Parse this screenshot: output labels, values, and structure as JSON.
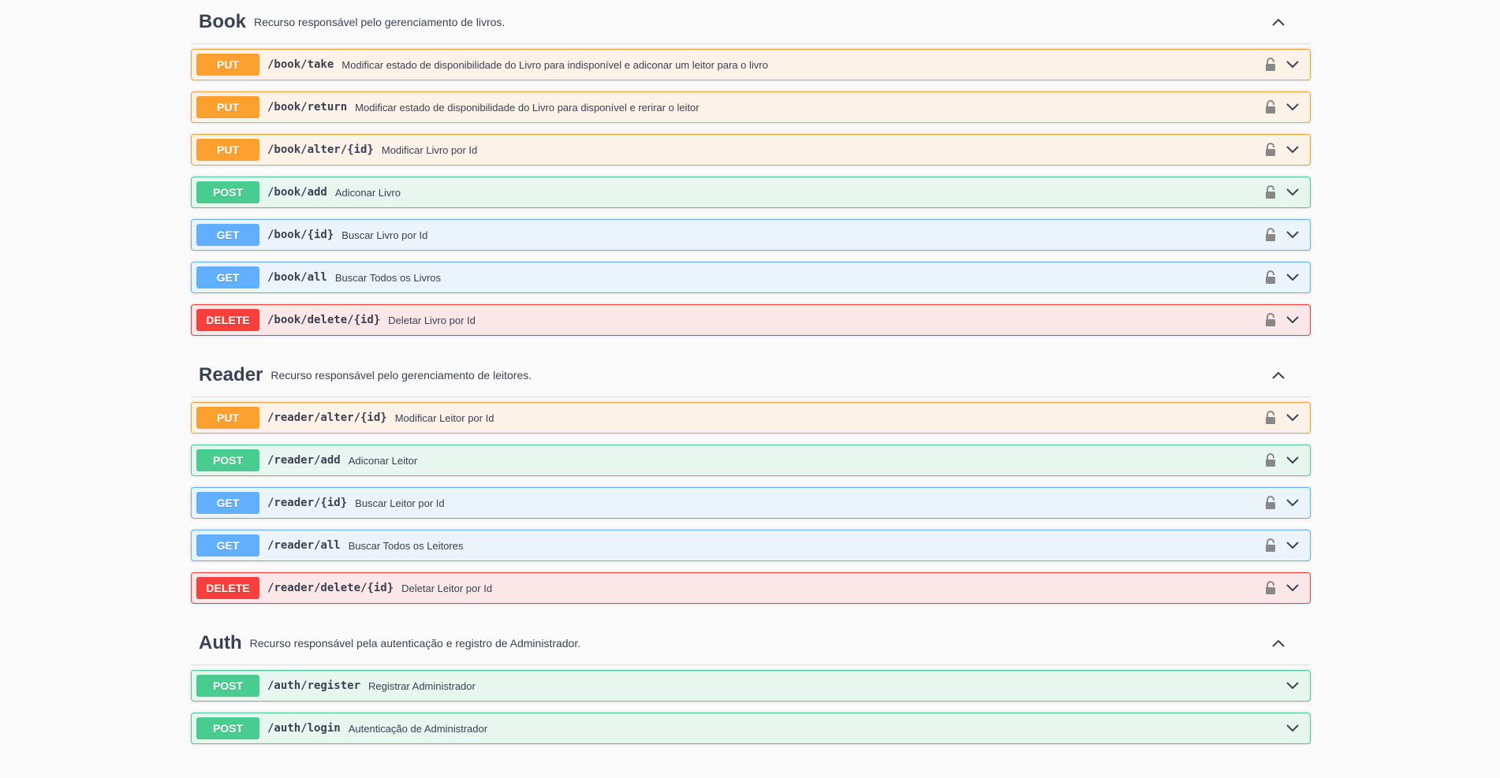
{
  "colors": {
    "put": "#fca130",
    "post": "#49cc90",
    "get": "#61affe",
    "delete": "#f93e3e"
  },
  "sections": [
    {
      "name": "Book",
      "description": "Recurso responsável pelo gerenciamento de livros.",
      "operations": [
        {
          "method": "PUT",
          "path": "/book/take",
          "summary": "Modificar estado de disponibilidade do Livro para indisponível e adiconar um leitor para o livro",
          "locked": true
        },
        {
          "method": "PUT",
          "path": "/book/return",
          "summary": "Modificar estado de disponibilidade do Livro para disponível e rerirar o leitor",
          "locked": true
        },
        {
          "method": "PUT",
          "path": "/book/alter/{id}",
          "summary": "Modificar Livro por Id",
          "locked": true
        },
        {
          "method": "POST",
          "path": "/book/add",
          "summary": "Adiconar Livro",
          "locked": true
        },
        {
          "method": "GET",
          "path": "/book/{id}",
          "summary": "Buscar Livro por Id",
          "locked": true
        },
        {
          "method": "GET",
          "path": "/book/all",
          "summary": "Buscar Todos os Livros",
          "locked": true
        },
        {
          "method": "DELETE",
          "path": "/book/delete/{id}",
          "summary": "Deletar Livro por Id",
          "locked": true
        }
      ]
    },
    {
      "name": "Reader",
      "description": "Recurso responsável pelo gerenciamento de leitores.",
      "operations": [
        {
          "method": "PUT",
          "path": "/reader/alter/{id}",
          "summary": "Modificar Leitor por Id",
          "locked": true
        },
        {
          "method": "POST",
          "path": "/reader/add",
          "summary": "Adiconar Leitor",
          "locked": true
        },
        {
          "method": "GET",
          "path": "/reader/{id}",
          "summary": "Buscar Leitor por Id",
          "locked": true
        },
        {
          "method": "GET",
          "path": "/reader/all",
          "summary": "Buscar Todos os Leitores",
          "locked": true
        },
        {
          "method": "DELETE",
          "path": "/reader/delete/{id}",
          "summary": "Deletar Leitor por Id",
          "locked": true
        }
      ]
    },
    {
      "name": "Auth",
      "description": "Recurso responsável pela autenticação e registro de Administrador.",
      "operations": [
        {
          "method": "POST",
          "path": "/auth/register",
          "summary": "Registrar Administrador",
          "locked": false
        },
        {
          "method": "POST",
          "path": "/auth/login",
          "summary": "Autenticação de Administrador",
          "locked": false
        }
      ]
    }
  ]
}
